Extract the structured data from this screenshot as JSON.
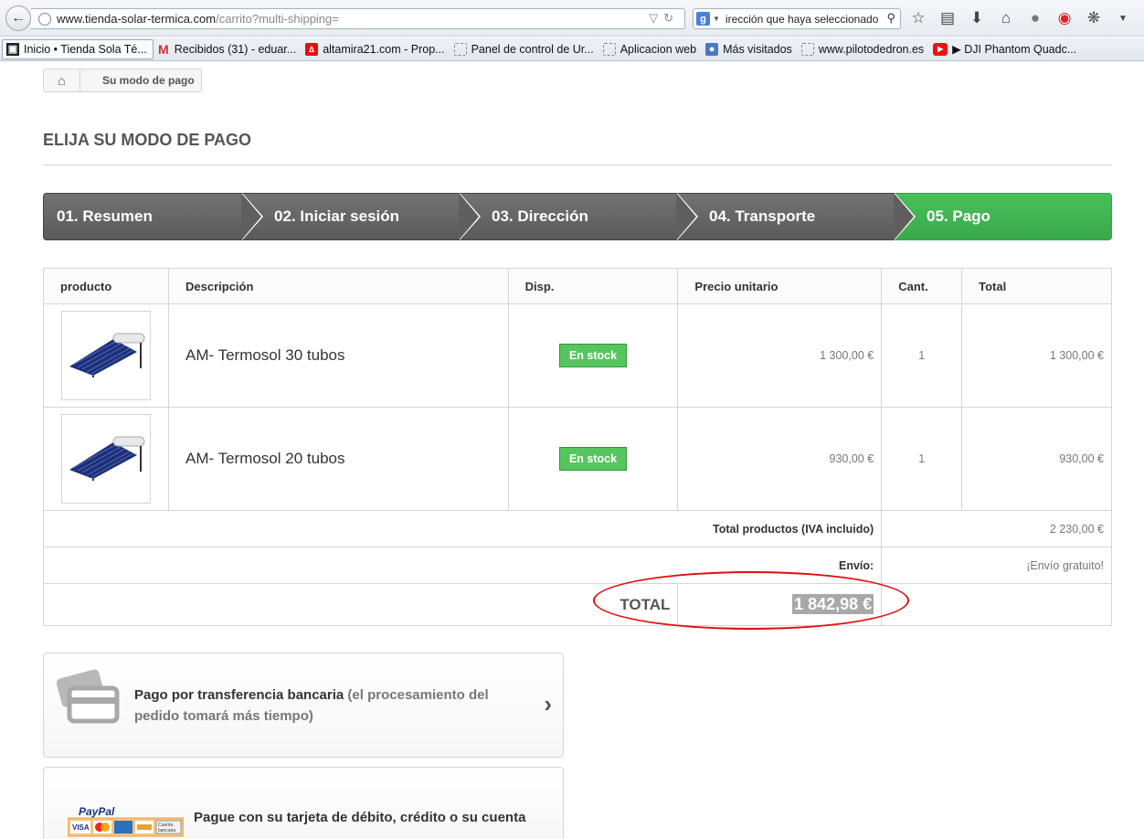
{
  "browser": {
    "url_domain": "www.tienda-solar-termica.com",
    "url_path": "/carrito?multi-shipping=",
    "search_text": "irección que haya seleccionado.",
    "bookmarks": [
      "Inicio • Tienda Sola Té...",
      "Recibidos (31) - eduar...",
      "altamira21.com - Prop...",
      "Panel de control de Ur...",
      "Aplicacion web",
      "Más visitados",
      "www.pilotodedron.es",
      "▶ DJI Phantom Quadc..."
    ]
  },
  "breadcrumb": {
    "label": "Su modo de pago"
  },
  "page_heading": "ELIJA SU MODO DE PAGO",
  "steps": [
    "01. Resumen",
    "02. Iniciar sesión",
    "03. Dirección",
    "04. Transporte",
    "05. Pago"
  ],
  "cart": {
    "headers": [
      "producto",
      "Descripción",
      "Disp.",
      "Precio unitario",
      "Cant.",
      "Total"
    ],
    "rows": [
      {
        "name": "AM- Termosol 30 tubos",
        "availability": "En stock",
        "unit_price": "1 300,00 €",
        "qty": "1",
        "total": "1 300,00 €"
      },
      {
        "name": "AM- Termosol 20 tubos",
        "availability": "En stock",
        "unit_price": "930,00 €",
        "qty": "1",
        "total": "930,00 €"
      }
    ],
    "total_products_label": "Total productos (IVA incluido)",
    "total_products_value": "2 230,00 €",
    "shipping_label": "Envío:",
    "shipping_value": "¡Envío gratuito!",
    "total_label": "TOTAL",
    "total_value": "1 842,98 €"
  },
  "payment": {
    "bankwire_title": "Pago por transferencia bancaria",
    "bankwire_note": "(el procesamiento del pedido tomará más tiempo)",
    "paypal_text": "Pague con su tarjeta de débito, crédito o su cuenta",
    "paypal_logo": "PayPal",
    "paypal_cards": [
      "VISA",
      "MasterCard",
      "Amex",
      "Cuenta bancaria"
    ]
  },
  "colors": {
    "active_step": "#41b553",
    "inactive_step": "#666666",
    "stock_badge": "#55c65e",
    "annotation_circle": "#e01010"
  }
}
